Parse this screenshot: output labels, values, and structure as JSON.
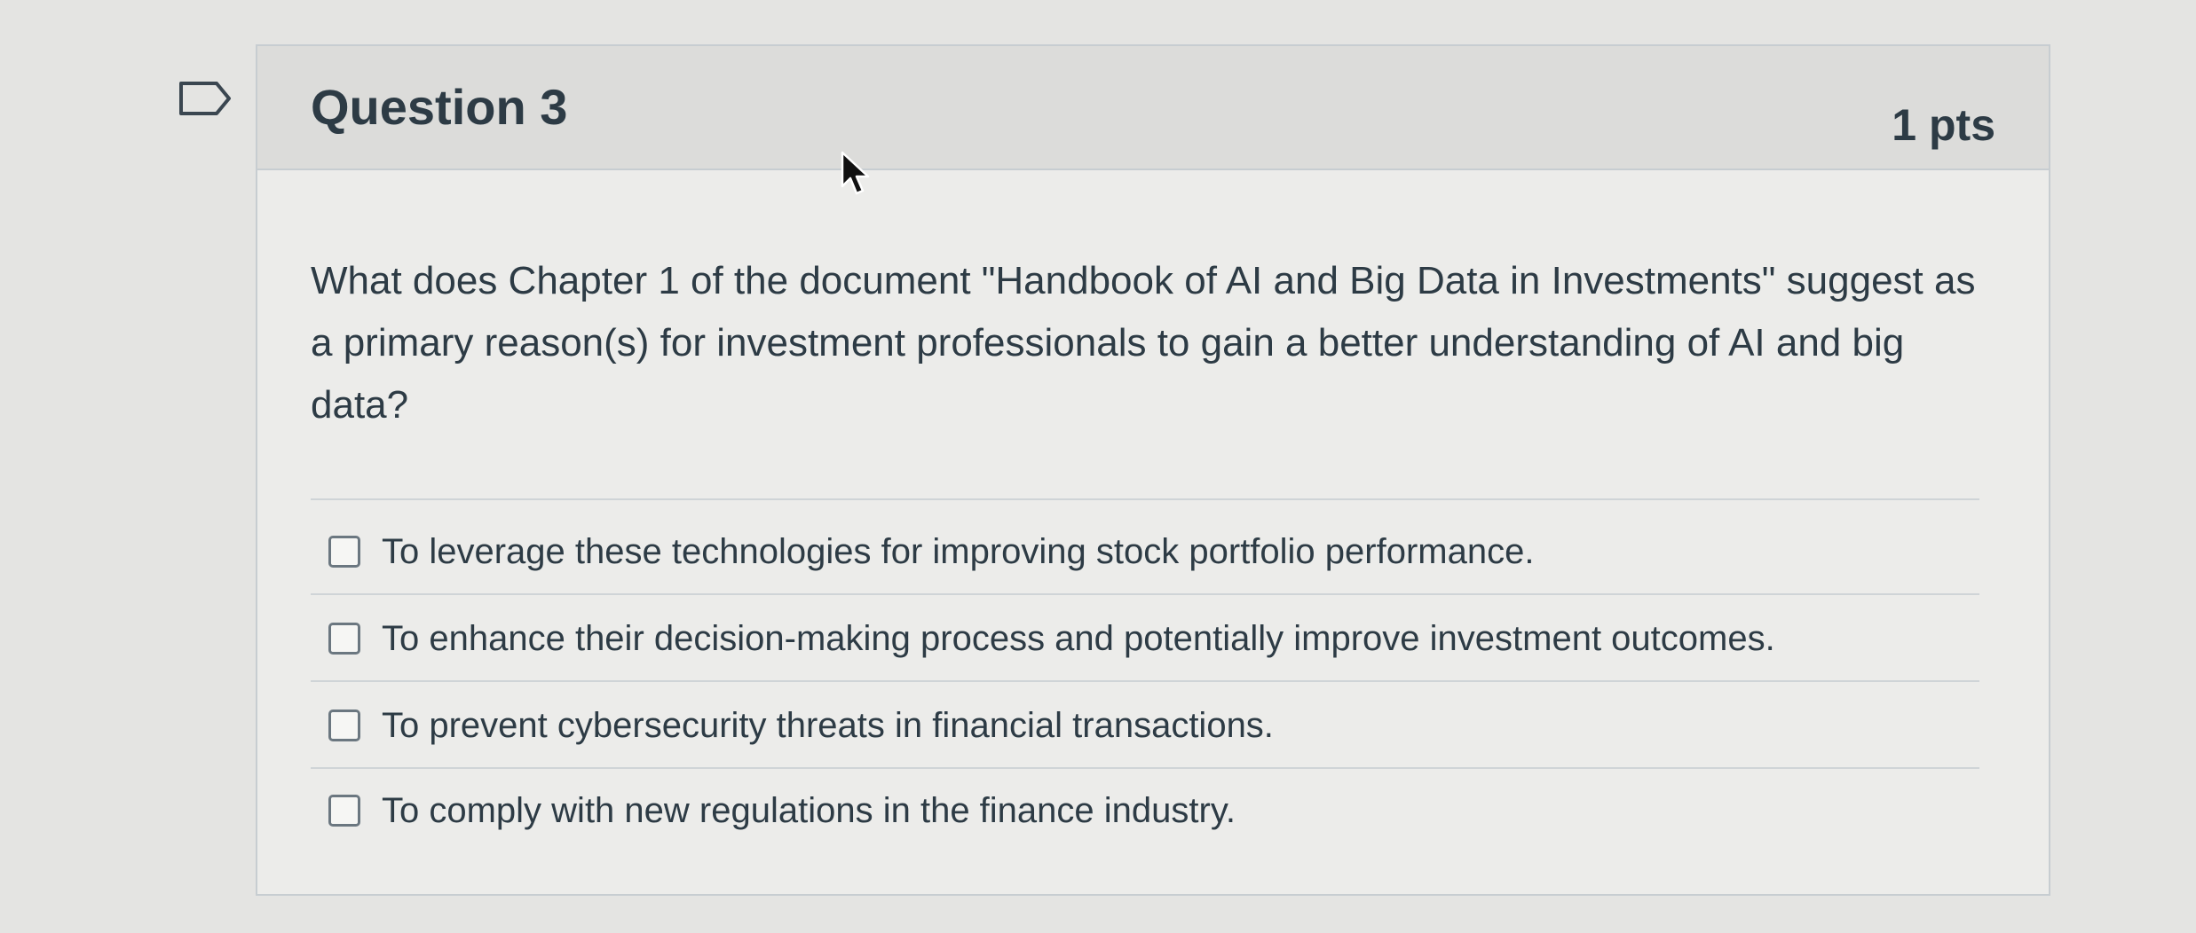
{
  "question": {
    "title": "Question 3",
    "points": "1 pts",
    "text": "What does Chapter 1 of the document \"Handbook of AI and Big Data in Investments\" suggest as a primary reason(s) for investment professionals to gain a better understanding of AI and big data?",
    "answers": [
      {
        "label": "To leverage these technologies for improving stock portfolio performance.",
        "checked": false
      },
      {
        "label": "To enhance their decision-making process and potentially improve investment outcomes.",
        "checked": false
      },
      {
        "label": "To prevent cybersecurity threats in financial transactions.",
        "checked": false
      },
      {
        "label": "To comply with new regulations in the finance industry.",
        "checked": false
      }
    ]
  },
  "icons": {
    "flag": "flag-icon",
    "cursor": "mouse-cursor-icon"
  },
  "colors": {
    "text": "#2d3b45",
    "header_bg": "#dcdcda",
    "border": "#c7cdd1"
  }
}
